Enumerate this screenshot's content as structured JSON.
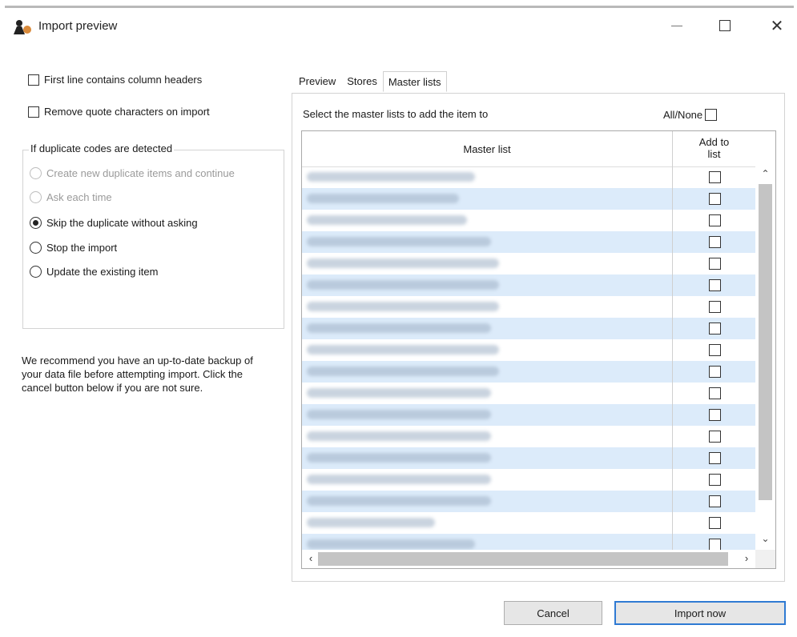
{
  "window": {
    "title": "Import preview"
  },
  "options": {
    "first_line_headers": "First line contains column headers",
    "remove_quotes": "Remove quote characters on import"
  },
  "duplicates": {
    "legend": "If duplicate codes are detected",
    "choices": [
      {
        "label": "Create new duplicate items and continue",
        "enabled": false,
        "selected": false
      },
      {
        "label": "Ask each time",
        "enabled": false,
        "selected": false
      },
      {
        "label": "Skip the duplicate without asking",
        "enabled": true,
        "selected": true
      },
      {
        "label": "Stop the import",
        "enabled": true,
        "selected": false
      },
      {
        "label": "Update the existing item",
        "enabled": true,
        "selected": false
      }
    ]
  },
  "note": "We recommend you have an up-to-date backup of your data file before attempting import. Click the cancel button below if you are not sure.",
  "tabs": [
    {
      "label": "Preview",
      "active": false
    },
    {
      "label": "Stores",
      "active": false
    },
    {
      "label": "Master lists",
      "active": true
    }
  ],
  "master_lists": {
    "instruction": "Select the master lists to add the item to",
    "all_none": "All/None",
    "columns": {
      "master_list": "Master list",
      "add_to_list": "Add to\nlist"
    },
    "row_count": 18
  },
  "buttons": {
    "cancel": "Cancel",
    "import_now": "Import now"
  }
}
